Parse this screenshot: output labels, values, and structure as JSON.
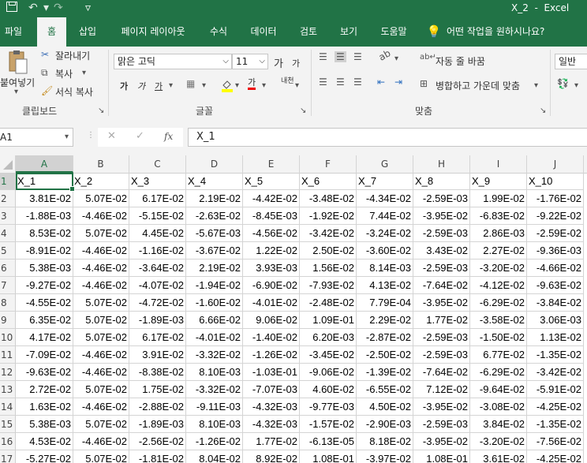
{
  "titlebar": {
    "title": "X_2  -  Excel",
    "undo": "↶",
    "redo": "↷",
    "dropdown": "▾",
    "more": "▿"
  },
  "tabs": [
    "파일",
    "홈",
    "삽입",
    "페이지 레이아웃",
    "수식",
    "데이터",
    "검토",
    "보기",
    "도움말"
  ],
  "tell_me": "어떤 작업을 원하시나요?",
  "ribbon": {
    "clipboard": {
      "paste": "붙여넣기",
      "cut": "잘라내기",
      "copy": "복사",
      "format_painter": "서식 복사",
      "label": "클립보드"
    },
    "font": {
      "name": "맑은 고딕",
      "size": "11",
      "grow": "가",
      "shrink": "가",
      "bold": "가",
      "italic": "가",
      "underline": "가",
      "font_color": "가",
      "phonetic": "내천",
      "label": "글꼴"
    },
    "alignment": {
      "wrap": "자동 줄 바꿈",
      "merge": "병합하고 가운데 맞춤",
      "label": "맞춤"
    },
    "number": {
      "format": "일반"
    }
  },
  "formula_bar": {
    "name_box": "A1",
    "fx": "fx",
    "content": "X_1",
    "cancel": "✕",
    "enter": "✓"
  },
  "columns": [
    "A",
    "B",
    "C",
    "D",
    "E",
    "F",
    "G",
    "H",
    "I",
    "J"
  ],
  "header_row": [
    "X_1",
    "X_2",
    "X_3",
    "X_4",
    "X_5",
    "X_6",
    "X_7",
    "X_8",
    "X_9",
    "X_10"
  ],
  "row_numbers": [
    "1",
    "2",
    "3",
    "4",
    "5",
    "6",
    "7",
    "8",
    "9",
    "10",
    "11",
    "12",
    "13",
    "14",
    "15",
    "16",
    "17"
  ],
  "rows": [
    [
      "3.81E-02",
      "5.07E-02",
      "6.17E-02",
      "2.19E-02",
      "-4.42E-02",
      "-3.48E-02",
      "-4.34E-02",
      "-2.59E-03",
      "1.99E-02",
      "-1.76E-02"
    ],
    [
      "-1.88E-03",
      "-4.46E-02",
      "-5.15E-02",
      "-2.63E-02",
      "-8.45E-03",
      "-1.92E-02",
      "7.44E-02",
      "-3.95E-02",
      "-6.83E-02",
      "-9.22E-02"
    ],
    [
      "8.53E-02",
      "5.07E-02",
      "4.45E-02",
      "-5.67E-03",
      "-4.56E-02",
      "-3.42E-02",
      "-3.24E-02",
      "-2.59E-03",
      "2.86E-03",
      "-2.59E-02"
    ],
    [
      "-8.91E-02",
      "-4.46E-02",
      "-1.16E-02",
      "-3.67E-02",
      "1.22E-02",
      "2.50E-02",
      "-3.60E-02",
      "3.43E-02",
      "2.27E-02",
      "-9.36E-03"
    ],
    [
      "5.38E-03",
      "-4.46E-02",
      "-3.64E-02",
      "2.19E-02",
      "3.93E-03",
      "1.56E-02",
      "8.14E-03",
      "-2.59E-03",
      "-3.20E-02",
      "-4.66E-02"
    ],
    [
      "-9.27E-02",
      "-4.46E-02",
      "-4.07E-02",
      "-1.94E-02",
      "-6.90E-02",
      "-7.93E-02",
      "4.13E-02",
      "-7.64E-02",
      "-4.12E-02",
      "-9.63E-02"
    ],
    [
      "-4.55E-02",
      "5.07E-02",
      "-4.72E-02",
      "-1.60E-02",
      "-4.01E-02",
      "-2.48E-02",
      "7.79E-04",
      "-3.95E-02",
      "-6.29E-02",
      "-3.84E-02"
    ],
    [
      "6.35E-02",
      "5.07E-02",
      "-1.89E-03",
      "6.66E-02",
      "9.06E-02",
      "1.09E-01",
      "2.29E-02",
      "1.77E-02",
      "-3.58E-02",
      "3.06E-03"
    ],
    [
      "4.17E-02",
      "5.07E-02",
      "6.17E-02",
      "-4.01E-02",
      "-1.40E-02",
      "6.20E-03",
      "-2.87E-02",
      "-2.59E-03",
      "-1.50E-02",
      "1.13E-02"
    ],
    [
      "-7.09E-02",
      "-4.46E-02",
      "3.91E-02",
      "-3.32E-02",
      "-1.26E-02",
      "-3.45E-02",
      "-2.50E-02",
      "-2.59E-03",
      "6.77E-02",
      "-1.35E-02"
    ],
    [
      "-9.63E-02",
      "-4.46E-02",
      "-8.38E-02",
      "8.10E-03",
      "-1.03E-01",
      "-9.06E-02",
      "-1.39E-02",
      "-7.64E-02",
      "-6.29E-02",
      "-3.42E-02"
    ],
    [
      "2.72E-02",
      "5.07E-02",
      "1.75E-02",
      "-3.32E-02",
      "-7.07E-03",
      "4.60E-02",
      "-6.55E-02",
      "7.12E-02",
      "-9.64E-02",
      "-5.91E-02"
    ],
    [
      "1.63E-02",
      "-4.46E-02",
      "-2.88E-02",
      "-9.11E-03",
      "-4.32E-03",
      "-9.77E-03",
      "4.50E-02",
      "-3.95E-02",
      "-3.08E-02",
      "-4.25E-02"
    ],
    [
      "5.38E-03",
      "5.07E-02",
      "-1.89E-03",
      "8.10E-03",
      "-4.32E-03",
      "-1.57E-02",
      "-2.90E-03",
      "-2.59E-03",
      "3.84E-02",
      "-1.35E-02"
    ],
    [
      "4.53E-02",
      "-4.46E-02",
      "-2.56E-02",
      "-1.26E-02",
      "1.77E-02",
      "-6.13E-05",
      "8.18E-02",
      "-3.95E-02",
      "-3.20E-02",
      "-7.56E-02"
    ],
    [
      "-5.27E-02",
      "5.07E-02",
      "-1.81E-02",
      "8.04E-02",
      "8.92E-02",
      "1.08E-01",
      "-3.97E-02",
      "1.08E-01",
      "3.61E-02",
      "-4.25E-02"
    ]
  ],
  "colors": {
    "accent": "#217346",
    "grid": "#d4d4d4"
  }
}
